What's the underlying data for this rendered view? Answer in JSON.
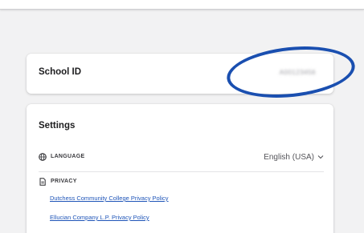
{
  "school_card": {
    "label": "School ID",
    "value": "A00123456"
  },
  "settings": {
    "title": "Settings",
    "language": {
      "label": "LANGUAGE",
      "value": "English (USA)",
      "icon": "globe-icon"
    },
    "privacy": {
      "label": "PRIVACY",
      "icon": "document-icon",
      "links": [
        "Dutchess Community College Privacy Policy",
        "Ellucian Company L.P. Privacy Policy"
      ]
    }
  },
  "annotation": {
    "ring_color": "#1a4fb0"
  },
  "colors": {
    "link": "#1f55b8",
    "background": "#f2f2f3",
    "card": "#ffffff"
  }
}
